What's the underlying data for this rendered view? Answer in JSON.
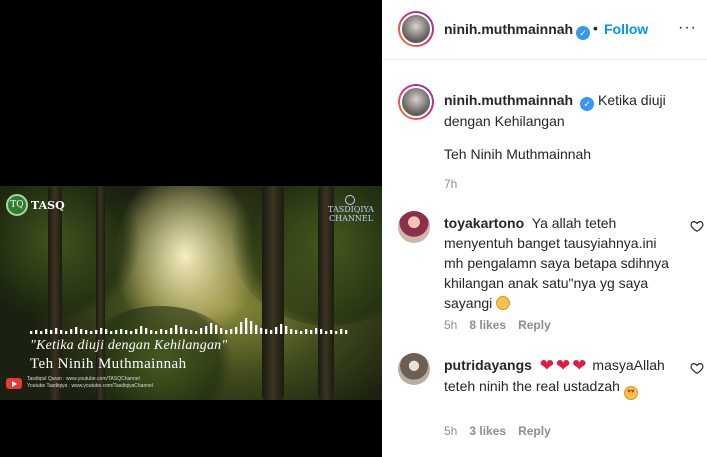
{
  "media": {
    "logo_left": "TASQ",
    "logo_left_badge": "TQ",
    "logo_right_line1": "TASDIQIYA",
    "logo_right_line2": "CHANNEL",
    "title_line1": "\"Ketika diuji dengan Kehilangan\"",
    "title_line2": "Teh Ninih Muthmainnah",
    "yt_line1": "Tasdiqiul Quran : www.youtube.com/TASQChannel",
    "yt_line2": "Youtube Tasdiqiya : www.youtube.com/TasdiqiyaChannel"
  },
  "header": {
    "username": "ninih.muthmainnah",
    "verified_glyph": "✓",
    "separator": "•",
    "follow_label": "Follow",
    "more_glyph": "···"
  },
  "caption": {
    "username": "ninih.muthmainnah",
    "text": "Ketika diuji dengan Kehilangan",
    "extra": "Teh Ninih Muthmainnah",
    "time": "7h"
  },
  "comments": [
    {
      "username": "toyakartono",
      "text": "Ya allah teteh menyentuh banget tausyiahnya.ini mh pengalamn saya betapa sdihnya khilangan anak satu\"nya yg saya sayangi",
      "time": "5h",
      "likes": "8 likes",
      "reply": "Reply"
    },
    {
      "username": "putridayangs",
      "hearts": "❤❤❤",
      "text": "masyaAllah teteh ninih the real ustadzah",
      "time": "5h",
      "likes": "3 likes",
      "reply": "Reply"
    }
  ],
  "colors": {
    "accent": "#0095f6",
    "verified": "#3897f0",
    "secondary_text": "#8e8e8e",
    "heart_red": "#e31b3c"
  },
  "icons": [
    "verified-badge-icon",
    "more-options-icon",
    "heart-outline-icon",
    "youtube-icon"
  ]
}
